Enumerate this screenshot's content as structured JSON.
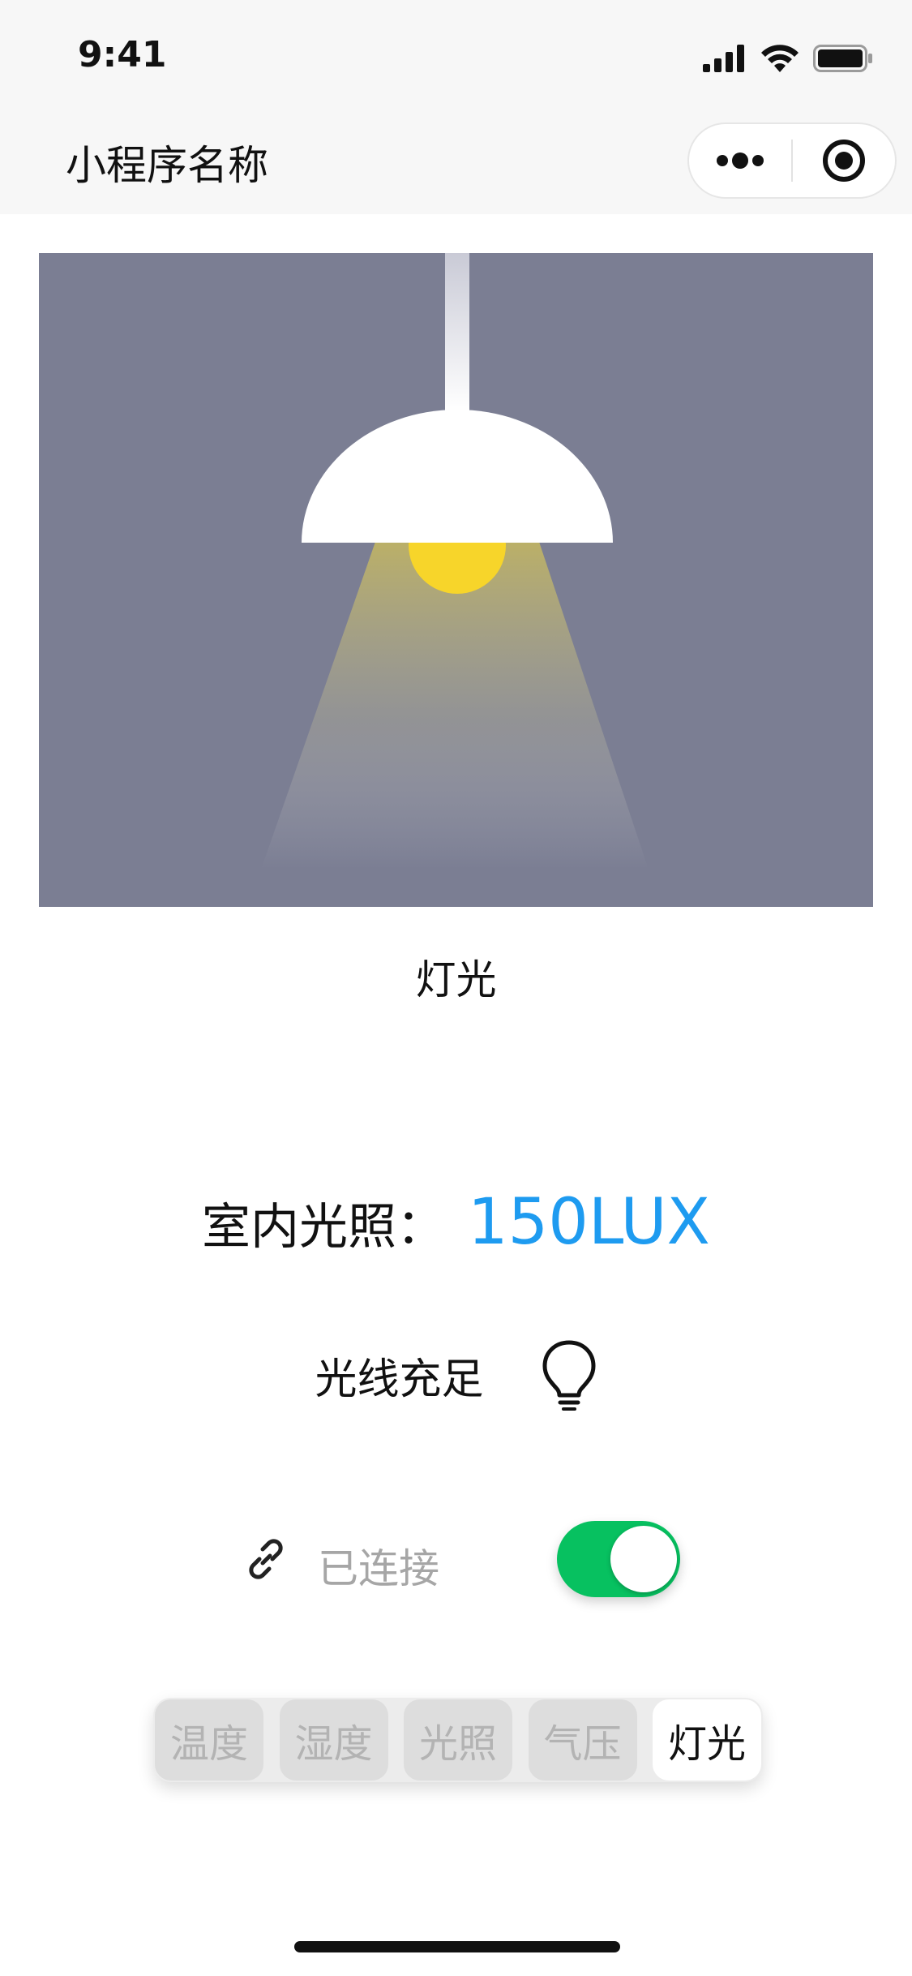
{
  "status_bar": {
    "time": "9:41"
  },
  "nav": {
    "title": "小程序名称",
    "more_icon": "more-dots-icon",
    "close_icon": "target-circle-icon"
  },
  "hero": {
    "caption": "灯光",
    "colors": {
      "background": "#7b7e93",
      "shade": "#ffffff",
      "bulb": "#f7d52a"
    }
  },
  "reading": {
    "label": "室内光照：",
    "value": "150LUX",
    "value_color": "#1e9bf0"
  },
  "status": {
    "text": "光线充足",
    "icon": "lightbulb-icon"
  },
  "connection": {
    "label": "已连接",
    "icon": "link-icon",
    "toggle_on": true,
    "toggle_color": "#07c160"
  },
  "tabs": [
    {
      "label": "温度",
      "active": false
    },
    {
      "label": "湿度",
      "active": false
    },
    {
      "label": "光照",
      "active": false
    },
    {
      "label": "气压",
      "active": false
    },
    {
      "label": "灯光",
      "active": true
    }
  ]
}
